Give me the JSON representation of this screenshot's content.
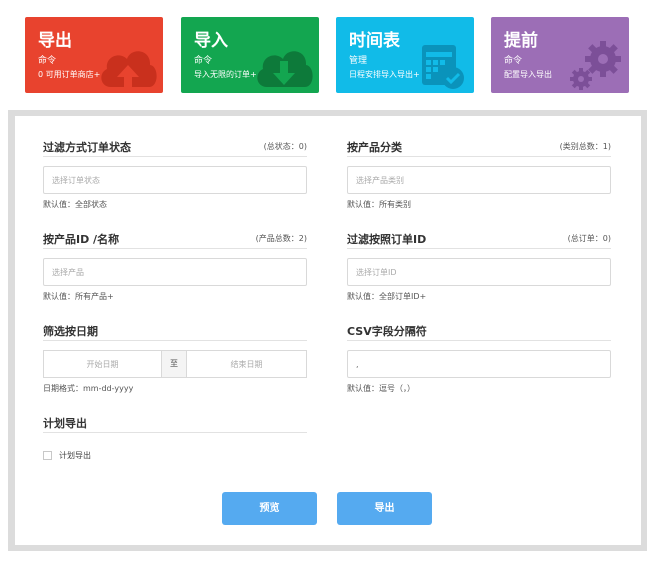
{
  "tiles": [
    {
      "title": "导出",
      "sub": "命令",
      "desc": "0 可用订单商店+"
    },
    {
      "title": "导入",
      "sub": "命令",
      "desc": "导入无限的订单+"
    },
    {
      "title": "时间表",
      "sub": "管理",
      "desc": "日程安排导入导出+"
    },
    {
      "title": "提前",
      "sub": "命令",
      "desc": "配置导入导出"
    }
  ],
  "form": {
    "order_status": {
      "label": "过滤方式订单状态",
      "count": "(总状态：0)",
      "placeholder": "选择订单状态",
      "hint": "默认值：全部状态"
    },
    "category": {
      "label": "按产品分类",
      "count": "(类别总数：1)",
      "placeholder": "选择产品类别",
      "hint": "默认值：所有类别"
    },
    "product": {
      "label": "按产品ID /名称",
      "count": "(产品总数：2)",
      "placeholder": "选择产品",
      "hint": "默认值：所有产品+"
    },
    "order_id": {
      "label": "过滤按照订单ID",
      "count": "(总订单：0)",
      "placeholder": "选择订单ID",
      "hint": "默认值：全部订单ID+"
    },
    "date": {
      "label": "筛选按日期",
      "start_placeholder": "开始日期",
      "separator": "至",
      "end_placeholder": "结束日期",
      "hint": "日期格式：mm-dd-yyyy"
    },
    "csv": {
      "label": "CSV字段分隔符",
      "value": ",",
      "hint": "默认值：逗号（，）"
    },
    "schedule": {
      "label": "计划导出",
      "checkbox_label": "计划导出"
    }
  },
  "buttons": {
    "preview": "预览",
    "export": "导出"
  },
  "colors": {
    "export_tile": "#e8432e",
    "import_tile": "#13a650",
    "schedule_tile": "#11bbe8",
    "advance_tile": "#9c6eb6",
    "button": "#55aaf0"
  },
  "icons": [
    "cloud-upload-icon",
    "cloud-download-icon",
    "calendar-check-icon",
    "gears-icon"
  ]
}
